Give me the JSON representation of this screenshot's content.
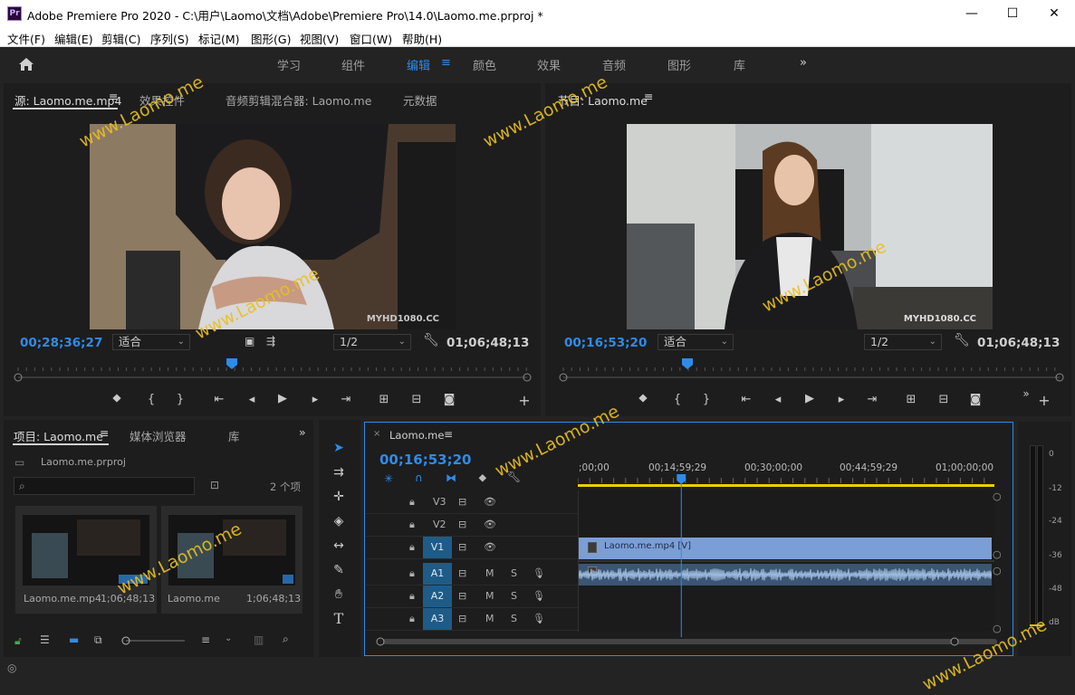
{
  "window": {
    "title": "Adobe Premiere Pro 2020 - C:\\用户\\Laomo\\文档\\Adobe\\Premiere Pro\\14.0\\Laomo.me.prproj *",
    "logo": "Pr"
  },
  "menu": [
    "文件(F)",
    "编辑(E)",
    "剪辑(C)",
    "序列(S)",
    "标记(M)",
    "图形(G)",
    "视图(V)",
    "窗口(W)",
    "帮助(H)"
  ],
  "workspaces": [
    "学习",
    "组件",
    "编辑",
    "颜色",
    "效果",
    "音频",
    "图形",
    "库"
  ],
  "workspace_active": "编辑",
  "source_panel": {
    "tabs": [
      "源: Laomo.me.mp4",
      "效果控件",
      "音频剪辑混合器: Laomo.me",
      "元数据"
    ],
    "watermark_text": "MYHD1080.CC",
    "timecode": "00;28;36;27",
    "fit": "适合",
    "resolution": "1/2",
    "duration": "01;06;48;13",
    "playhead_fraction": 0.42
  },
  "program_panel": {
    "tab": "节目: Laomo.me",
    "watermark_text": "MYHD1080.CC",
    "timecode": "00;16;53;20",
    "fit": "适合",
    "resolution": "1/2",
    "duration": "01;06;48;13",
    "playhead_fraction": 0.25
  },
  "project_panel": {
    "tabs": [
      "项目: Laomo.me",
      "媒体浏览器",
      "库"
    ],
    "file": "Laomo.me.prproj",
    "count": "2 个项",
    "items": [
      {
        "name": "Laomo.me.mp4",
        "duration": "1;06;48;13"
      },
      {
        "name": "Laomo.me",
        "duration": "1;06;48;13"
      }
    ]
  },
  "timeline": {
    "tab": "Laomo.me",
    "timecode": "00;16;53;20",
    "ruler": [
      ";00;00",
      "00;14;59;29",
      "00;30;00;00",
      "00;44;59;29",
      "01;00;00;00"
    ],
    "video_tracks": [
      "V3",
      "V2",
      "V1"
    ],
    "audio_tracks": [
      "A1",
      "A2",
      "A3"
    ],
    "clip_label": "Laomo.me.mp4 [V]",
    "mute_label": "M",
    "solo_label": "S",
    "playhead_fraction": 0.25
  },
  "meter": {
    "labels": [
      "0",
      "-12",
      "-24",
      "-36",
      "-48",
      "dB"
    ]
  },
  "watermark": "www.Laomo.me",
  "colors": {
    "accent": "#2d8ceb",
    "clip": "#7b9ed6",
    "track_badge": "#1f5b87",
    "ruler_yellow": "#e8d000"
  }
}
